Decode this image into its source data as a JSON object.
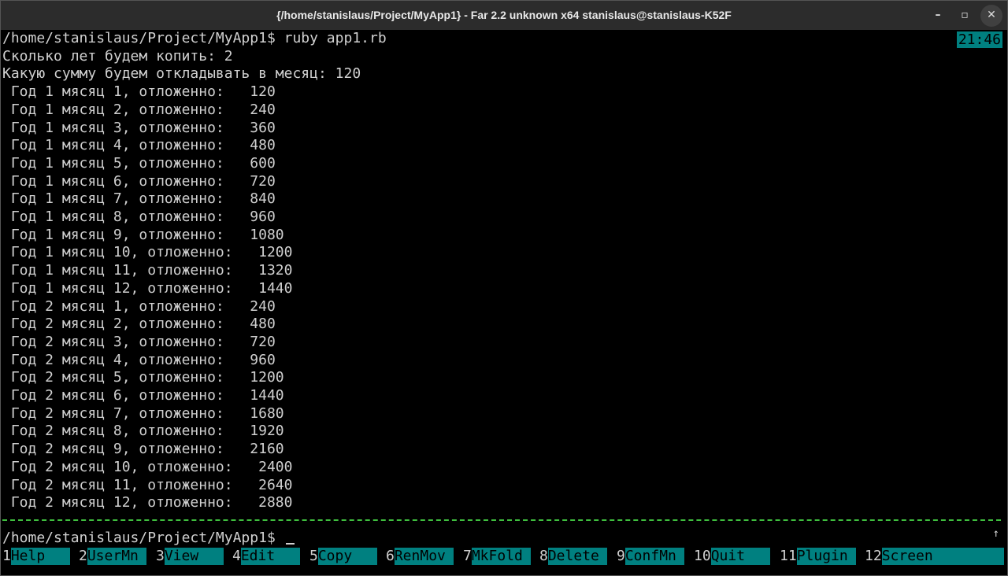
{
  "window": {
    "title": "{/home/stanislaus/Project/MyApp1} - Far 2.2 unknown x64 stanislaus@stanislaus-K52F",
    "minimize_glyph": "–",
    "maximize_glyph": "▫",
    "close_glyph": "✕"
  },
  "terminal": {
    "clock": "21:46",
    "lines": [
      "/home/stanislaus/Project/MyApp1$ ruby app1.rb",
      "Сколько лет будем копить: 2",
      "Какую сумму будем откладывать в месяц: 120",
      " Год 1 мясяц 1, отложенно:   120",
      " Год 1 мясяц 2, отложенно:   240",
      " Год 1 мясяц 3, отложенно:   360",
      " Год 1 мясяц 4, отложенно:   480",
      " Год 1 мясяц 5, отложенно:   600",
      " Год 1 мясяц 6, отложенно:   720",
      " Год 1 мясяц 7, отложенно:   840",
      " Год 1 мясяц 8, отложенно:   960",
      " Год 1 мясяц 9, отложенно:   1080",
      " Год 1 мясяц 10, отложенно:   1200",
      " Год 1 мясяц 11, отложенно:   1320",
      " Год 1 мясяц 12, отложенно:   1440",
      " Год 2 мясяц 1, отложенно:   240",
      " Год 2 мясяц 2, отложенно:   480",
      " Год 2 мясяц 3, отложенно:   720",
      " Год 2 мясяц 4, отложенно:   960",
      " Год 2 мясяц 5, отложенно:   1200",
      " Год 2 мясяц 6, отложенно:   1440",
      " Год 2 мясяц 7, отложенно:   1680",
      " Год 2 мясяц 8, отложенно:   1920",
      " Год 2 мясяц 9, отложенно:   2160",
      " Год 2 мясяц 10, отложенно:   2400",
      " Год 2 мясяц 11, отложенно:   2640",
      " Год 2 мясяц 12, отложенно:   2880"
    ],
    "prompt": "/home/stanislaus/Project/MyApp1$",
    "scroll_indicator": "↑"
  },
  "function_keys": [
    {
      "num": "1",
      "label": "Help"
    },
    {
      "num": "2",
      "label": "UserMn"
    },
    {
      "num": "3",
      "label": "View"
    },
    {
      "num": "4",
      "label": "Edit"
    },
    {
      "num": "5",
      "label": "Copy"
    },
    {
      "num": "6",
      "label": "RenMov"
    },
    {
      "num": "7",
      "label": "MkFold"
    },
    {
      "num": "8",
      "label": "Delete"
    },
    {
      "num": "9",
      "label": "ConfMn"
    },
    {
      "num": "10",
      "label": "Quit"
    },
    {
      "num": "11",
      "label": "Plugin"
    },
    {
      "num": "12",
      "label": "Screen"
    }
  ],
  "colors": {
    "accent_cyan": "#008080",
    "divider_green": "#3fbf3f",
    "text": "#d0d0d0"
  }
}
